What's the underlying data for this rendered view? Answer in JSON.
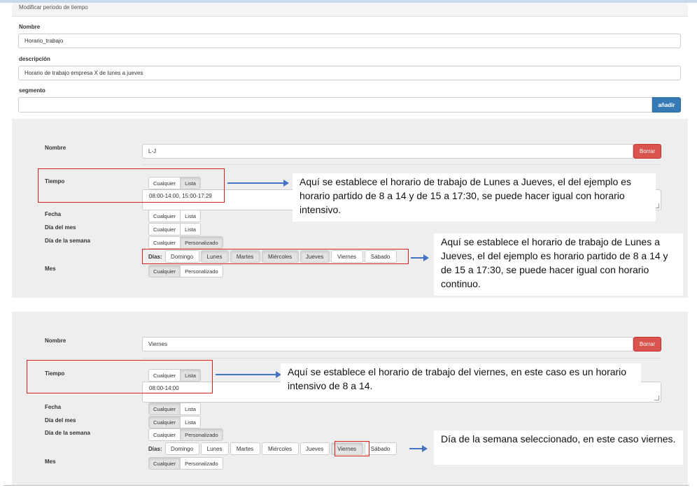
{
  "header": {
    "title": "Modificar periodo de tiempo"
  },
  "form": {
    "nombre_label": "Nombre",
    "nombre_value": "Horario_trabajo",
    "descripcion_label": "descripción",
    "descripcion_value": "Horario de trabajo empresa X de lunes a jueves",
    "segmento_label": "segmento",
    "segmento_value": "",
    "add_button": "añadir"
  },
  "segments": [
    {
      "nombre_label": "Nombre",
      "nombre_value": "L-J",
      "delete_button": "Borrar",
      "tiempo_label": "Tiempo",
      "tiempo_options": [
        "Cualquier",
        "Lista"
      ],
      "tiempo_value": "08:00-14:00, 15:00-17:29",
      "fecha_label": "Fecha",
      "fecha_options": [
        "Cualquier",
        "Lista"
      ],
      "dia_mes_label": "Día del mes",
      "dia_mes_options": [
        "Cualquier",
        "Lista"
      ],
      "dia_semana_label": "Día de la semana",
      "dia_semana_options": [
        "Cualquier",
        "Personalizado"
      ],
      "dias_label": "Días:",
      "days": [
        "Domingo",
        "Lunes",
        "Martes",
        "Miércoles",
        "Jueves",
        "Viernes",
        "Sábado"
      ],
      "days_selected": [
        "Lunes",
        "Martes",
        "Miércoles",
        "Jueves"
      ],
      "mes_label": "Mes",
      "mes_options": [
        "Cualquier",
        "Personalizado"
      ]
    },
    {
      "nombre_label": "Nombre",
      "nombre_value": "Viernes",
      "delete_button": "Borrar",
      "tiempo_label": "Tiempo",
      "tiempo_options": [
        "Cualquier",
        "Lista"
      ],
      "tiempo_value": "08:00-14:00",
      "fecha_label": "Fecha",
      "fecha_options": [
        "Cualquier",
        "Lista"
      ],
      "dia_mes_label": "Día del mes",
      "dia_mes_options": [
        "Cualquier",
        "Lista"
      ],
      "dia_semana_label": "Día de la semana",
      "dia_semana_options": [
        "Cualquier",
        "Personalizado"
      ],
      "dias_label": "Días:",
      "days": [
        "Domingo",
        "Lunes",
        "Martes",
        "Miércoles",
        "Jueves",
        "Viernes",
        "Sábado"
      ],
      "days_selected": [
        "Viernes"
      ],
      "mes_label": "Mes",
      "mes_options": [
        "Cualquier",
        "Personalizado"
      ]
    }
  ],
  "callouts": {
    "tiempo_lj": "Aquí se establece el horario de trabajo de Lunes a Jueves, el del ejemplo es horario partido de 8 a 14 y de 15 a 17:30, se puede hacer igual con horario intensivo.",
    "dias_lj": "Aquí se establece el horario de trabajo de Lunes a Jueves, el del ejemplo es horario partido de 8 a 14 y de 15 a 17:30, se puede hacer igual con horario continuo.",
    "tiempo_v": "Aquí se establece el horario de trabajo del viernes, en este caso es un horario intensivo de 8 a 14.",
    "dias_v": "Día de la semana seleccionado, en este caso viernes."
  },
  "colors": {
    "primary": "#337ab7",
    "danger": "#d9534f",
    "highlight_border": "#d62020",
    "arrow": "#4472c4",
    "section_bg": "#eeeeee"
  }
}
